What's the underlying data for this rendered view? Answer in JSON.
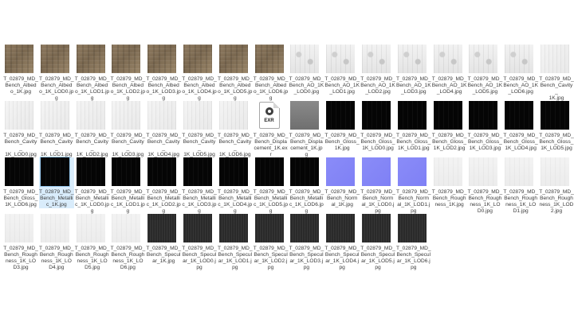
{
  "files": [
    {
      "name": "T_02879_MD_Bench_Albedo_1K.jpg",
      "label": "T_02879_MD_\nBench_Albed\no_1K.jpg",
      "kind": "albedo"
    },
    {
      "name": "T_02879_MD_Bench_Albedo_1K_LOD0.jpg",
      "label": "T_02879_MD_\nBench_Albed\no_1K_LOD0.jp\ng",
      "kind": "albedo"
    },
    {
      "name": "T_02879_MD_Bench_Albedo_1K_LOD1.jpg",
      "label": "T_02879_MD_\nBench_Albed\no_1K_LOD1.jp\ng",
      "kind": "albedo"
    },
    {
      "name": "T_02879_MD_Bench_Albedo_1K_LOD2.jpg",
      "label": "T_02879_MD_\nBench_Albed\no_1K_LOD2.jp\ng",
      "kind": "albedo"
    },
    {
      "name": "T_02879_MD_Bench_Albedo_1K_LOD3.jpg",
      "label": "T_02879_MD_\nBench_Albed\no_1K_LOD3.jp\ng",
      "kind": "albedo"
    },
    {
      "name": "T_02879_MD_Bench_Albedo_1K_LOD4.jpg",
      "label": "T_02879_MD_\nBench_Albed\no_1K_LOD4.jp\ng",
      "kind": "albedo"
    },
    {
      "name": "T_02879_MD_Bench_Albedo_1K_LOD5.jpg",
      "label": "T_02879_MD_\nBench_Albed\no_1K_LOD5.jp\ng",
      "kind": "albedo"
    },
    {
      "name": "T_02879_MD_Bench_Albedo_1K_LOD6.jpg",
      "label": "T_02879_MD_\nBench_Albed\no_1K_LOD6.jp\ng",
      "kind": "albedo"
    },
    {
      "name": "T_02879_MD_Bench_AO_1K_LOD0.jpg",
      "label": "T_02879_MD_\nBench_AO_1K\n_LOD0.jpg",
      "kind": "ao"
    },
    {
      "name": "T_02879_MD_Bench_AO_1K_LOD1.jpg",
      "label": "T_02879_MD_\nBench_AO_1K\n_LOD1.jpg",
      "kind": "ao"
    },
    {
      "name": "T_02879_MD_Bench_AO_1K_LOD2.jpg",
      "label": "T_02879_MD_\nBench_AO_1K\n_LOD2.jpg",
      "kind": "ao"
    },
    {
      "name": "T_02879_MD_Bench_AO_1K_LOD3.jpg",
      "label": "T_02879_MD_\nBench_AO_1K\n_LOD3.jpg",
      "kind": "ao"
    },
    {
      "name": "T_02879_MD_Bench_AO_1K_LOD4.jpg",
      "label": "T_02879_MD_\nBench_AO_1K\n_LOD4.jpg",
      "kind": "ao"
    },
    {
      "name": "T_02879_MD_Bench_AO_1K_LOD5.jpg",
      "label": "T_02879_MD_\nBench_AO_1K\n_LOD5.jpg",
      "kind": "ao"
    },
    {
      "name": "T_02879_MD_Bench_AO_1K_LOD6.jpg",
      "label": "T_02879_MD_\nBench_AO_1K\n_LOD6.jpg",
      "kind": "ao"
    },
    {
      "name": "T_02879_MD_Bench_Cavity_1K.jpg",
      "label": "T_02879_MD_\nBench_Cavity_\n1K.jpg",
      "kind": "cavity"
    },
    {
      "name": "T_02879_MD_Bench_Cavity_1K_LOD0.jpg",
      "label": "T_02879_MD_\nBench_Cavity_\n1K_LOD0.jpg",
      "kind": "cavity"
    },
    {
      "name": "T_02879_MD_Bench_Cavity_1K_LOD1.jpg",
      "label": "T_02879_MD_\nBench_Cavity_\n1K_LOD1.jpg",
      "kind": "cavity"
    },
    {
      "name": "T_02879_MD_Bench_Cavity_1K_LOD2.jpg",
      "label": "T_02879_MD_\nBench_Cavity_\n1K_LOD2.jpg",
      "kind": "cavity"
    },
    {
      "name": "T_02879_MD_Bench_Cavity_1K_LOD3.jpg",
      "label": "T_02879_MD_\nBench_Cavity_\n1K_LOD3.jpg",
      "kind": "cavity"
    },
    {
      "name": "T_02879_MD_Bench_Cavity_1K_LOD4.jpg",
      "label": "T_02879_MD_\nBench_Cavity_\n1K_LOD4.jpg",
      "kind": "cavity"
    },
    {
      "name": "T_02879_MD_Bench_Cavity_1K_LOD5.jpg",
      "label": "T_02879_MD_\nBench_Cavity_\n1K_LOD5.jpg",
      "kind": "cavity"
    },
    {
      "name": "T_02879_MD_Bench_Cavity_1K_LOD6.jpg",
      "label": "T_02879_MD_\nBench_Cavity_\n1K_LOD6.jpg",
      "kind": "cavity"
    },
    {
      "name": "T_02879_MD_Bench_Displacement_1K.exr",
      "label": "T_02879_MD_\nBench_Displa\ncement_1K.ex\nr",
      "kind": "exr",
      "ext": "EXR"
    },
    {
      "name": "T_02879_MD_Bench_Displacement_1K.jpg",
      "label": "T_02879_MD_\nBench_Displa\ncement_1K.jp\ng",
      "kind": "displace"
    },
    {
      "name": "T_02879_MD_Bench_Gloss_1K.jpg",
      "label": "T_02879_MD_\nBench_Gloss_\n1K.jpg",
      "kind": "black"
    },
    {
      "name": "T_02879_MD_Bench_Gloss_1K_LOD0.jpg",
      "label": "T_02879_MD_\nBench_Gloss_\n1K_LOD0.jpg",
      "kind": "black"
    },
    {
      "name": "T_02879_MD_Bench_Gloss_1K_LOD1.jpg",
      "label": "T_02879_MD_\nBench_Gloss_\n1K_LOD1.jpg",
      "kind": "black"
    },
    {
      "name": "T_02879_MD_Bench_Gloss_1K_LOD2.jpg",
      "label": "T_02879_MD_\nBench_Gloss_\n1K_LOD2.jpg",
      "kind": "black"
    },
    {
      "name": "T_02879_MD_Bench_Gloss_1K_LOD3.jpg",
      "label": "T_02879_MD_\nBench_Gloss_\n1K_LOD3.jpg",
      "kind": "black"
    },
    {
      "name": "T_02879_MD_Bench_Gloss_1K_LOD4.jpg",
      "label": "T_02879_MD_\nBench_Gloss_\n1K_LOD4.jpg",
      "kind": "black"
    },
    {
      "name": "T_02879_MD_Bench_Gloss_1K_LOD5.jpg",
      "label": "T_02879_MD_\nBench_Gloss_\n1K_LOD5.jpg",
      "kind": "black"
    },
    {
      "name": "T_02879_MD_Bench_Gloss_1K_LOD6.jpg",
      "label": "T_02879_MD_\nBench_Gloss_\n1K_LOD6.jpg",
      "kind": "black"
    },
    {
      "name": "T_02879_MD_Bench_Metallic_1K.jpg",
      "label": "T_02879_MD_\nBench_Metalli\nc_1K.jpg",
      "kind": "black",
      "selected": true
    },
    {
      "name": "T_02879_MD_Bench_Metallic_1K_LOD0.jpg",
      "label": "T_02879_MD_\nBench_Metalli\nc_1K_LOD0.jp\ng",
      "kind": "black"
    },
    {
      "name": "T_02879_MD_Bench_Metallic_1K_LOD1.jpg",
      "label": "T_02879_MD_\nBench_Metalli\nc_1K_LOD1.jp\ng",
      "kind": "black"
    },
    {
      "name": "T_02879_MD_Bench_Metallic_1K_LOD2.jpg",
      "label": "T_02879_MD_\nBench_Metalli\nc_1K_LOD2.jp\ng",
      "kind": "black"
    },
    {
      "name": "T_02879_MD_Bench_Metallic_1K_LOD3.jpg",
      "label": "T_02879_MD_\nBench_Metalli\nc_1K_LOD3.jp\ng",
      "kind": "black"
    },
    {
      "name": "T_02879_MD_Bench_Metallic_1K_LOD4.jpg",
      "label": "T_02879_MD_\nBench_Metalli\nc_1K_LOD4.jp\ng",
      "kind": "black"
    },
    {
      "name": "T_02879_MD_Bench_Metallic_1K_LOD5.jpg",
      "label": "T_02879_MD_\nBench_Metalli\nc_1K_LOD5.jp\ng",
      "kind": "black"
    },
    {
      "name": "T_02879_MD_Bench_Metallic_1K_LOD6.jpg",
      "label": "T_02879_MD_\nBench_Metalli\nc_1K_LOD6.jp\ng",
      "kind": "black"
    },
    {
      "name": "T_02879_MD_Bench_Normal_1K.jpg",
      "label": "T_02879_MD_\nBench_Norm\nal_1K.jpg",
      "kind": "normal"
    },
    {
      "name": "T_02879_MD_Bench_Normal_1K_LOD0.jpg",
      "label": "T_02879_MD_\nBench_Norm\nal_1K_LOD0.j\npg",
      "kind": "normal"
    },
    {
      "name": "T_02879_MD_Bench_Normal_1K_LOD1.jpg",
      "label": "T_02879_MD_\nBench_Norm\nal_1K_LOD1.j\npg",
      "kind": "normal"
    },
    {
      "name": "T_02879_MD_Bench_Roughness_1K.jpg",
      "label": "T_02879_MD_\nBench_Rough\nness_1K.jpg",
      "kind": "rough"
    },
    {
      "name": "T_02879_MD_Bench_Roughness_1K_LOD0.jpg",
      "label": "T_02879_MD_\nBench_Rough\nness_1K_LO\nD0.jpg",
      "kind": "rough"
    },
    {
      "name": "T_02879_MD_Bench_Roughness_1K_LOD1.jpg",
      "label": "T_02879_MD_\nBench_Rough\nness_1K_LO\nD1.jpg",
      "kind": "rough"
    },
    {
      "name": "T_02879_MD_Bench_Roughness_1K_LOD2.jpg",
      "label": "T_02879_MD_\nBench_Rough\nness_1K_LOD\n2.jpg",
      "kind": "rough"
    },
    {
      "name": "T_02879_MD_Bench_Roughness_1K_LOD3.jpg",
      "label": "T_02879_MD_\nBench_Rough\nness_1K_LO\nD3.jpg",
      "kind": "rough"
    },
    {
      "name": "T_02879_MD_Bench_Roughness_1K_LOD4.jpg",
      "label": "T_02879_MD_\nBench_Rough\nness_1K_LO\nD4.jpg",
      "kind": "rough"
    },
    {
      "name": "T_02879_MD_Bench_Roughness_1K_LOD5.jpg",
      "label": "T_02879_MD_\nBench_Rough\nness_1K_LO\nD5.jpg",
      "kind": "rough"
    },
    {
      "name": "T_02879_MD_Bench_Roughness_1K_LOD6.jpg",
      "label": "T_02879_MD_\nBench_Rough\nness_1K_LO\nD6.jpg",
      "kind": "rough"
    },
    {
      "name": "T_02879_MD_Bench_Specular_1K.jpg",
      "label": "T_02879_MD_\nBench_Specul\nar_1K.jpg",
      "kind": "specular"
    },
    {
      "name": "T_02879_MD_Bench_Specular_1K_LOD0.jpg",
      "label": "T_02879_MD_\nBench_Specul\nar_1K_LOD0.j\npg",
      "kind": "specular"
    },
    {
      "name": "T_02879_MD_Bench_Specular_1K_LOD1.jpg",
      "label": "T_02879_MD_\nBench_Specul\nar_1K_LOD1.j\npg",
      "kind": "specular"
    },
    {
      "name": "T_02879_MD_Bench_Specular_1K_LOD2.jpg",
      "label": "T_02879_MD_\nBench_Specul\nar_1K_LOD2.j\npg",
      "kind": "specular"
    },
    {
      "name": "T_02879_MD_Bench_Specular_1K_LOD3.jpg",
      "label": "T_02879_MD_\nBench_Specul\nar_1K_LOD3.j\npg",
      "kind": "specular"
    },
    {
      "name": "T_02879_MD_Bench_Specular_1K_LOD4.jpg",
      "label": "T_02879_MD_\nBench_Specul\nar_1K_LOD4.j\npg",
      "kind": "specular"
    },
    {
      "name": "T_02879_MD_Bench_Specular_1K_LOD5.jpg",
      "label": "T_02879_MD_\nBench_Specul\nar_1K_LOD5.j\npg",
      "kind": "specular"
    },
    {
      "name": "T_02879_MD_Bench_Specular_1K_LOD6.jpg",
      "label": "T_02879_MD_\nBench_Specul\nar_1K_LOD6.j\npg",
      "kind": "specular"
    }
  ],
  "colors": {
    "selection_bg": "#d9ecfb",
    "label_text": "#3b3b3b"
  }
}
